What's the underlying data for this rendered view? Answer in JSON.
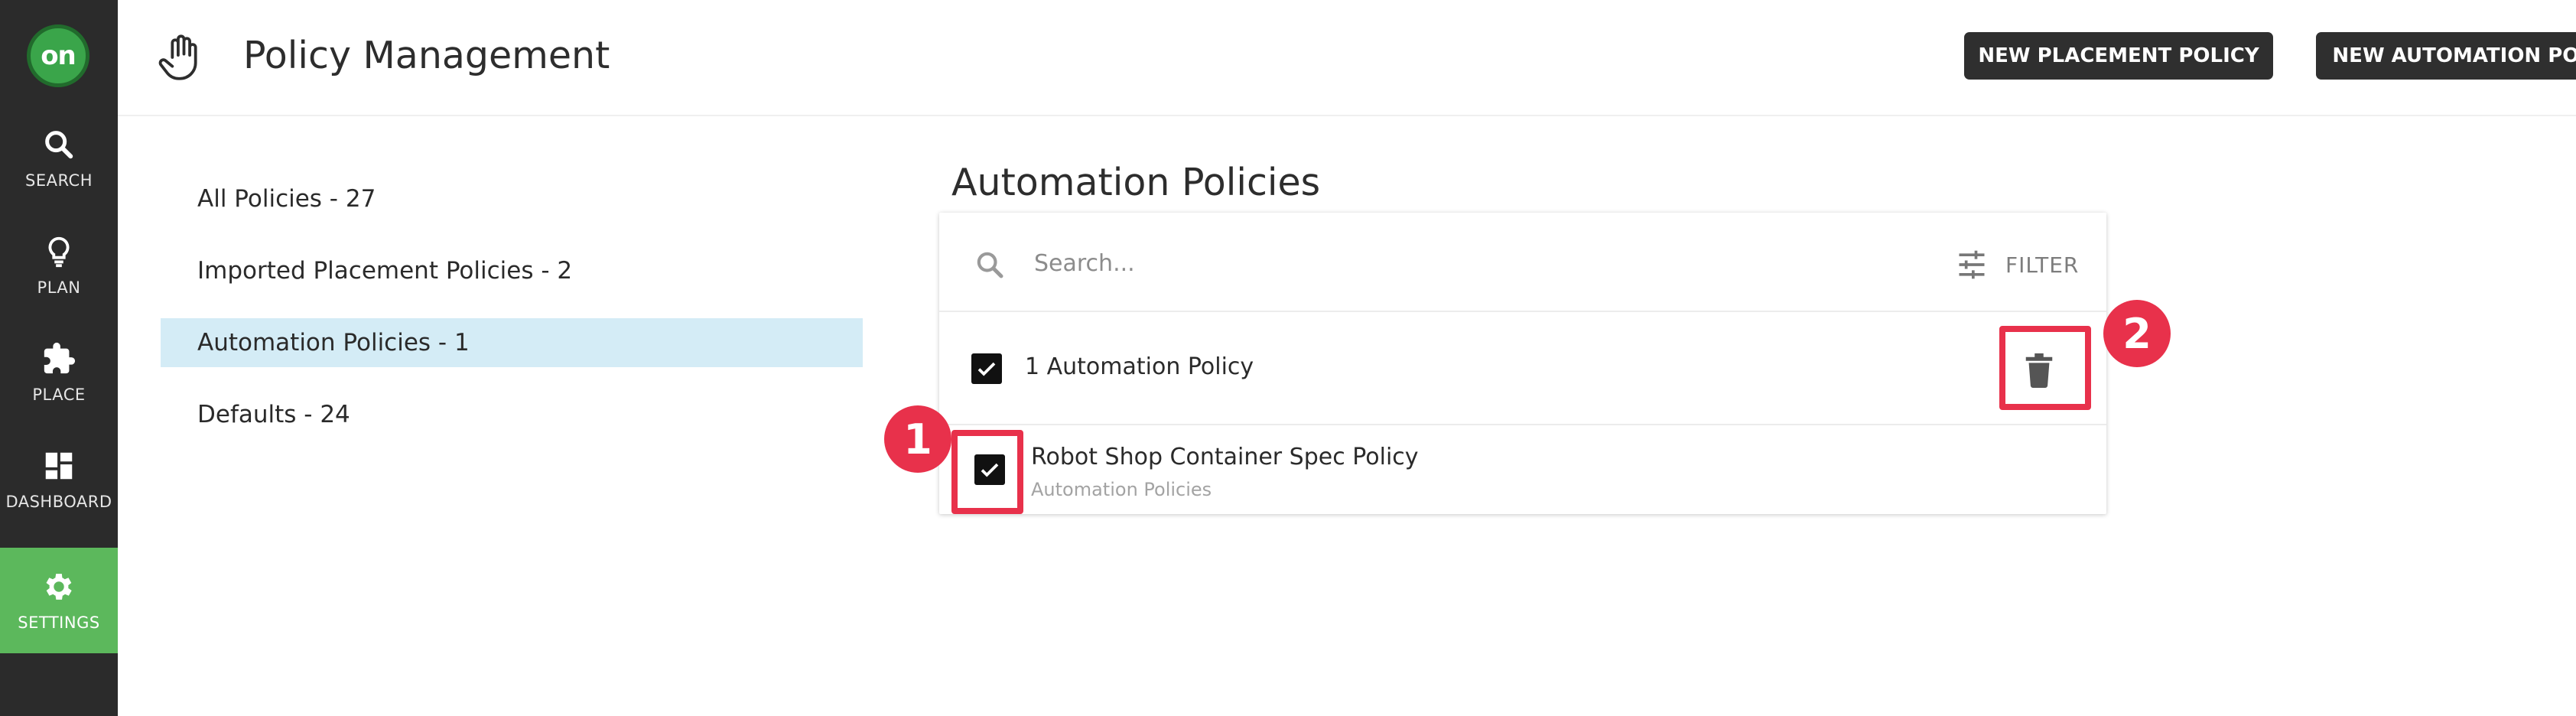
{
  "app": {
    "logo_text": "on"
  },
  "nav": {
    "items": [
      {
        "label": "SEARCH",
        "icon": "search-icon",
        "active": false
      },
      {
        "label": "PLAN",
        "icon": "lightbulb-icon",
        "active": false
      },
      {
        "label": "PLACE",
        "icon": "puzzle-icon",
        "active": false
      },
      {
        "label": "DASHBOARD",
        "icon": "dashboard-icon",
        "active": false
      },
      {
        "label": "SETTINGS",
        "icon": "gear-icon",
        "active": true
      }
    ]
  },
  "header": {
    "title": "Policy Management",
    "icon": "hand-icon",
    "buttons": {
      "new_placement": "NEW PLACEMENT POLICY",
      "new_automation": "NEW AUTOMATION POLICY"
    }
  },
  "categories": [
    {
      "label": "All Policies - 27",
      "selected": false
    },
    {
      "label": "Imported Placement Policies - 2",
      "selected": false
    },
    {
      "label": "Automation Policies - 1",
      "selected": true
    },
    {
      "label": "Defaults - 24",
      "selected": false
    }
  ],
  "main": {
    "section_title": "Automation Policies",
    "search": {
      "placeholder": "Search...",
      "value": ""
    },
    "filter_label": "FILTER",
    "list_header": {
      "count_label": "1 Automation Policy",
      "checked": true
    },
    "items": [
      {
        "title": "Robot Shop Container Spec Policy",
        "subtitle": "Automation Policies",
        "checked": true
      }
    ]
  },
  "annotations": {
    "badge_1": "1",
    "badge_2": "2",
    "color": "#e8314b"
  },
  "colors": {
    "rail_bg": "#2b2b2b",
    "active_nav": "#5cb85c",
    "selected_category": "#d4ecf6",
    "button_bg": "#2f2f2f",
    "logo_green": "#3aa54a"
  }
}
